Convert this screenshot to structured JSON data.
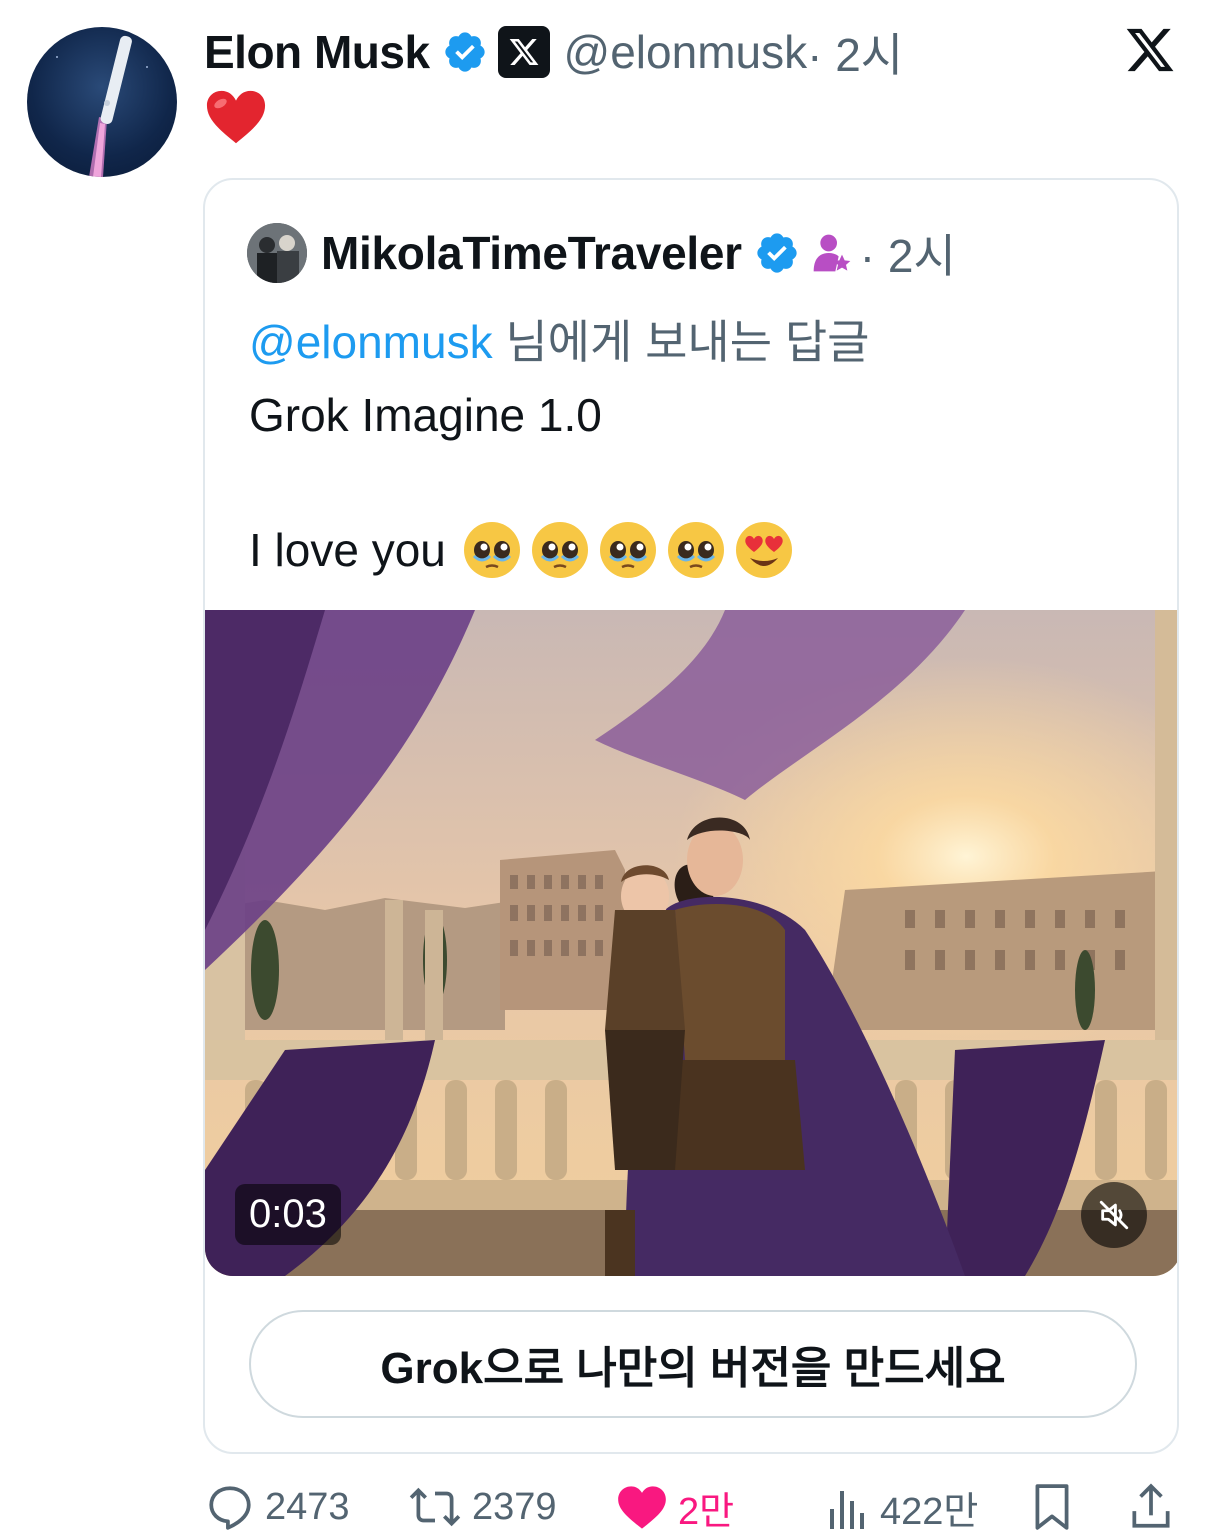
{
  "post": {
    "author_name": "Elon Musk",
    "handle": "@elonmusk",
    "time": " · 2시",
    "text_emoji": "red-heart-emoji"
  },
  "quote": {
    "author_name": "MikolaTimeTraveler",
    "time": "· 2시",
    "reply_mention": "@elonmusk",
    "reply_suffix": " 님에게 보내는 답글",
    "text_line1": "Grok Imagine 1.0",
    "text_line2": "I love you",
    "emojis": [
      "pleading-face-emoji",
      "pleading-face-emoji",
      "pleading-face-emoji",
      "pleading-face-emoji",
      "heart-eyes-emoji"
    ],
    "video_duration": "0:03",
    "grok_button_label": "Grok으로 나만의 버전을 만드세요"
  },
  "actions": {
    "replies": "2473",
    "reposts": "2379",
    "likes": "2만",
    "views": "422만"
  },
  "colors": {
    "verified_blue": "#1d9bf0",
    "like_pink": "#f91880",
    "muted_gray": "#536471"
  }
}
